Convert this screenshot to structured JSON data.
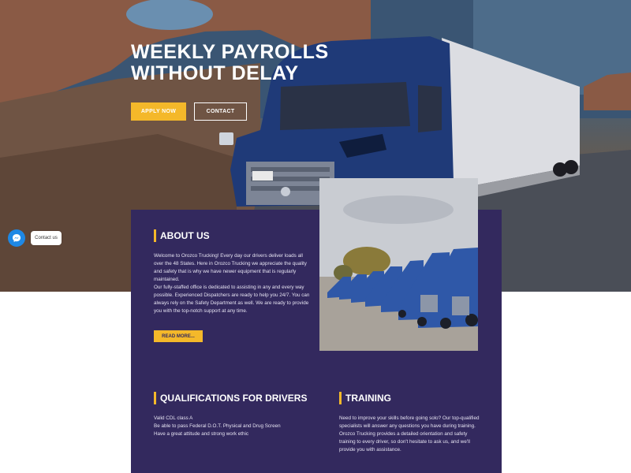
{
  "hero": {
    "title_line1": "WEEKLY PAYROLLS",
    "title_line2": "WITHOUT DELAY",
    "apply_label": "APPLY NOW",
    "contact_label": "CONTACT"
  },
  "chat": {
    "label": "Contact us",
    "icon": "messenger-icon"
  },
  "about": {
    "heading": "ABOUT US",
    "paragraph1": "Welcome to Orozco Trucking! Every day our drivers deliver loads all over the 48 States. Here in Orozco Trucking we appreciate the quality and safety that is why we have newer equipment that is regularly maintained.",
    "paragraph2": "Our fully-staffed office is dedicated to assisting in any and every way possible. Experienced Dispatchers are ready to help you 24/7. You can always rely on the Safety Department as well. We are ready to provide you with the top-notch support at any time.",
    "read_more_label": "READ MORE..."
  },
  "qualifications": {
    "heading": "QUALIFICATIONS FOR DRIVERS",
    "items": [
      "Valid CDL class A",
      "Be able to pass Federal D.O.T. Physical and Drug Screen",
      "Have a great attitude and strong work ethic"
    ]
  },
  "training": {
    "heading": "TRAINING",
    "paragraph": "Need to improve your skills before going solo? Our top-qualified specialists will answer any questions you have during training. Orozco Trucking provides a detailed orientation and safety training to every driver, so don't hesitate to ask us, and we'll provide you with assistance."
  },
  "colors": {
    "accent": "#f4b82a",
    "panel": "#33295e",
    "truck": "#1f3a78"
  }
}
